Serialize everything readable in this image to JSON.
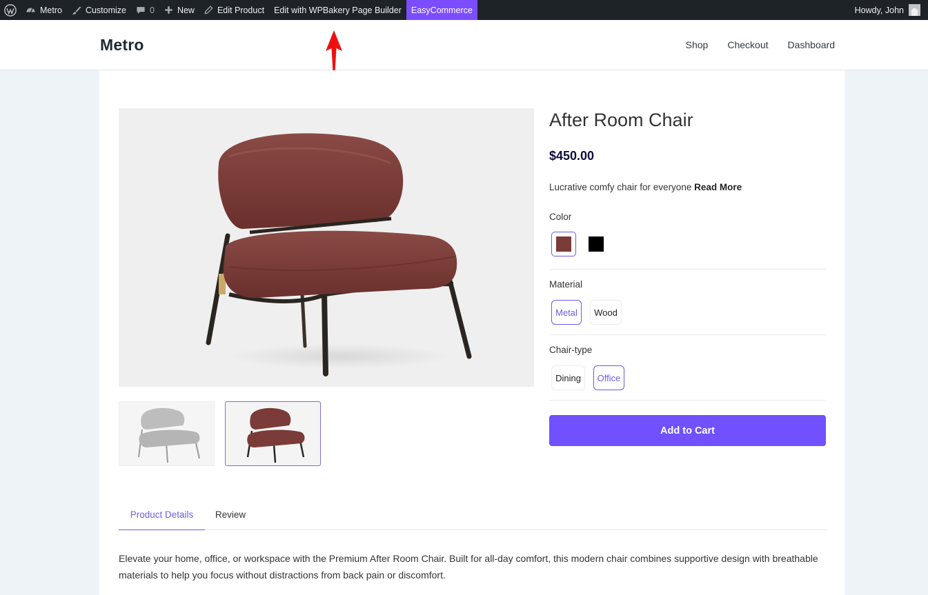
{
  "admin_bar": {
    "site_name": "Metro",
    "customize": "Customize",
    "comments_count": "0",
    "new": "New",
    "edit_product": "Edit Product",
    "edit_wpbakery": "Edit with WPBakery Page Builder",
    "easycommerce": "EasyCommerce",
    "howdy": "Howdy, John"
  },
  "header": {
    "site_title": "Metro",
    "nav": [
      "Shop",
      "Checkout",
      "Dashboard"
    ]
  },
  "product": {
    "title": "After Room Chair",
    "price": "$450.00",
    "short_description": "Lucrative comfy chair for everyone",
    "read_more": "Read More",
    "attributes": {
      "color": {
        "label": "Color",
        "options": [
          {
            "value": "#7b3b38",
            "selected": true
          },
          {
            "value": "#000000",
            "selected": false
          }
        ]
      },
      "material": {
        "label": "Material",
        "options": [
          {
            "label": "Metal",
            "selected": true
          },
          {
            "label": "Wood",
            "selected": false
          }
        ]
      },
      "chair_type": {
        "label": "Chair-type",
        "options": [
          {
            "label": "Dining",
            "selected": false
          },
          {
            "label": "Office",
            "selected": true
          }
        ]
      }
    },
    "add_to_cart": "Add to Cart",
    "tabs": [
      {
        "label": "Product Details",
        "active": true
      },
      {
        "label": "Review",
        "active": false
      }
    ],
    "long_description": "Elevate your home, office, or workspace with the Premium After Room Chair. Built for all-day comfort, this modern chair combines supportive design with breathable materials to help you focus without distractions from back pain or discomfort."
  },
  "colors": {
    "accent": "#7c4dff",
    "button": "#7050ff",
    "selected_border": "#6c5ce7",
    "chair_fabric": "#7b3b38"
  }
}
